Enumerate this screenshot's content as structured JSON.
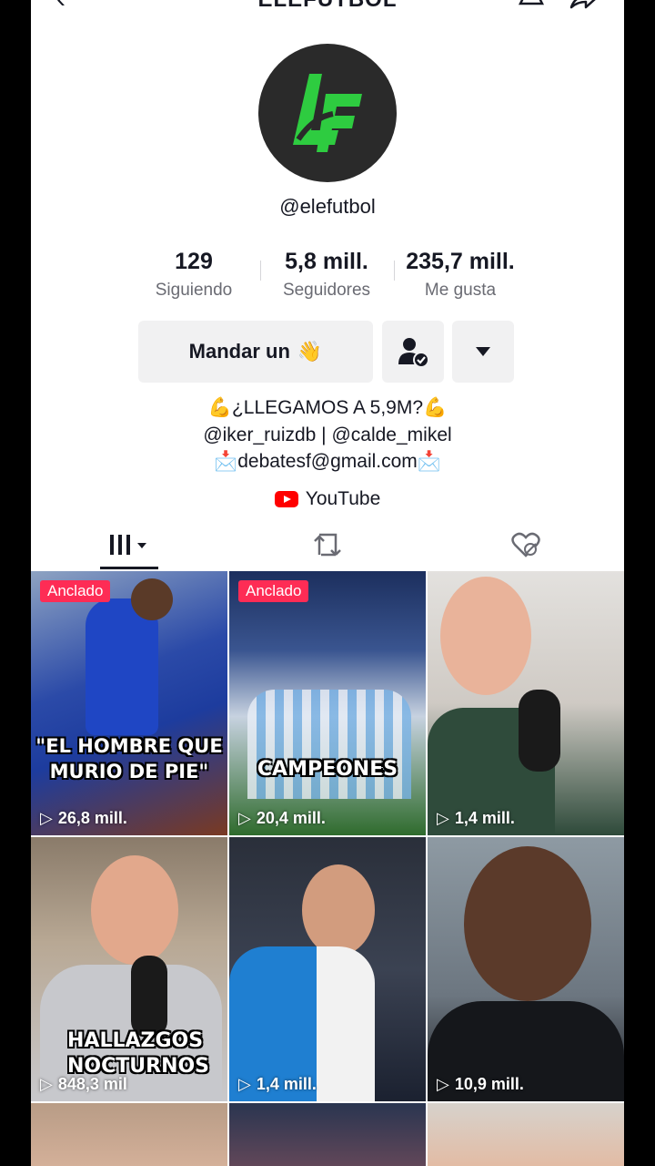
{
  "header": {
    "title": "ELEFUTBOL"
  },
  "profile": {
    "username": "@elefutbol",
    "stats": [
      {
        "value": "129",
        "label": "Siguiendo"
      },
      {
        "value": "5,8 mill.",
        "label": "Seguidores"
      },
      {
        "value": "235,7 mill.",
        "label": "Me gusta"
      }
    ],
    "message_button": "Mandar un",
    "bio_lines": [
      "💪¿LLEGAMOS A 5,9M?💪",
      "@iker_ruizdb | @calde_mikel",
      "📩debatesf@gmail.com📩"
    ],
    "link": "YouTube"
  },
  "videos": [
    {
      "pinned": "Anclado",
      "caption": "\"EL HOMBRE QUE MURIO DE PIE\"",
      "views": "26,8 mill."
    },
    {
      "pinned": "Anclado",
      "caption": "CAMPEONES",
      "views": "20,4 mill."
    },
    {
      "views": "1,4 mill."
    },
    {
      "caption": "HALLAZGOS NOCTURNOS",
      "views": "848,3 mil"
    },
    {
      "views": "1,4 mill."
    },
    {
      "views": "10,9 mill."
    }
  ],
  "colors": {
    "accent": "#fe2c55",
    "logo_green": "#2ecc40"
  }
}
